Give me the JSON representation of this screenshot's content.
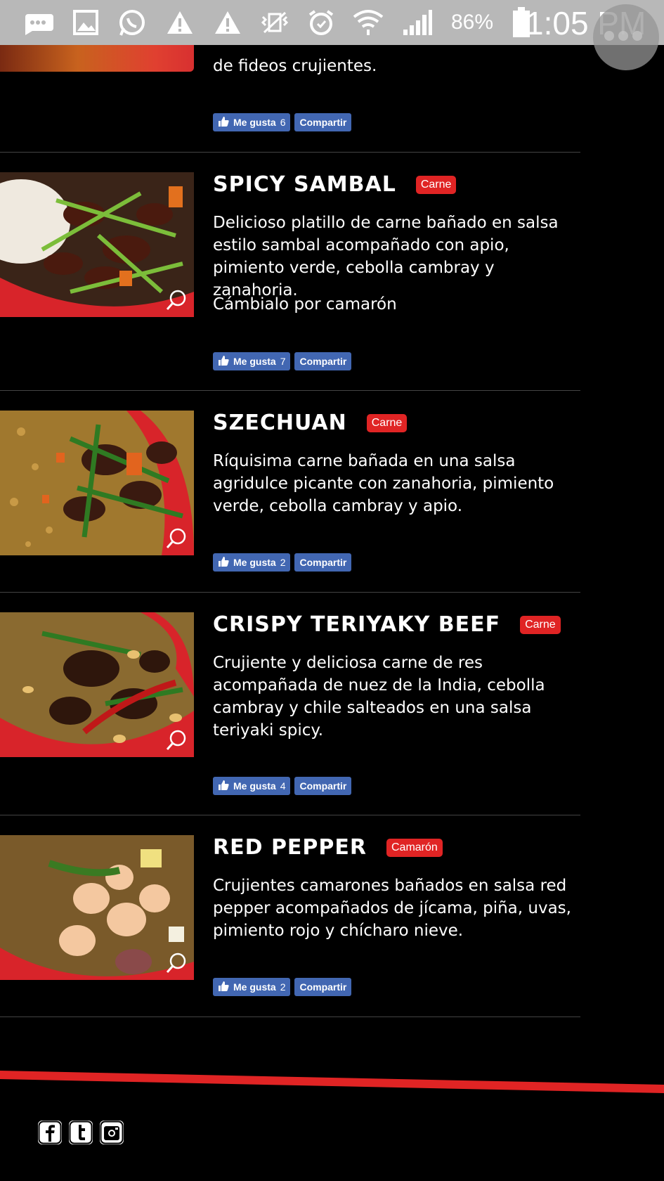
{
  "status_bar": {
    "battery_percent": "86%",
    "time": "1:05 PM",
    "icons": [
      "message-icon",
      "gallery-icon",
      "whatsapp-icon",
      "warning-icon",
      "warning-icon",
      "vibrate-mute-icon",
      "alarm-icon",
      "wifi-icon",
      "signal-icon",
      "battery-icon"
    ]
  },
  "top_partial": {
    "description_tail": "de fideos crujientes.",
    "like_label": "Me gusta",
    "like_count": "6",
    "share_label": "Compartir"
  },
  "items": [
    {
      "title": "SPICY SAMBAL",
      "badge": "Carne",
      "description": "Delicioso platillo de carne bañado en salsa estilo sambal acompañado con apio, pimiento verde, cebolla cambray y zanahoria.",
      "extra": "Cámbialo por camarón",
      "like_label": "Me gusta",
      "like_count": "7",
      "share_label": "Compartir"
    },
    {
      "title": "SZECHUAN",
      "badge": "Carne",
      "description": "Ríquisima carne bañada en una salsa agridulce picante con zanahoria, pimiento verde, cebolla cambray y apio.",
      "like_label": "Me gusta",
      "like_count": "2",
      "share_label": "Compartir"
    },
    {
      "title": "CRISPY TERIYAKY BEEF",
      "badge": "Carne",
      "description": "Crujiente y deliciosa carne de res acompañada de nuez de la India, cebolla cambray y chile salteados en una salsa teriyaki spicy.",
      "like_label": "Me gusta",
      "like_count": "4",
      "share_label": "Compartir"
    },
    {
      "title": "RED PEPPER",
      "badge": "Camarón",
      "description": "Crujientes camarones bañados en salsa red pepper acompañados de jícama, piña, uvas, pimiento rojo y chícharo nieve.",
      "like_label": "Me gusta",
      "like_count": "2",
      "share_label": "Compartir"
    }
  ],
  "footer": {
    "social_icons": [
      "facebook-icon",
      "twitter-icon",
      "instagram-icon"
    ],
    "accent_color": "#e02424"
  },
  "colors": {
    "background": "#000000",
    "badge": "#e02424",
    "facebook_button": "#4267b2"
  }
}
